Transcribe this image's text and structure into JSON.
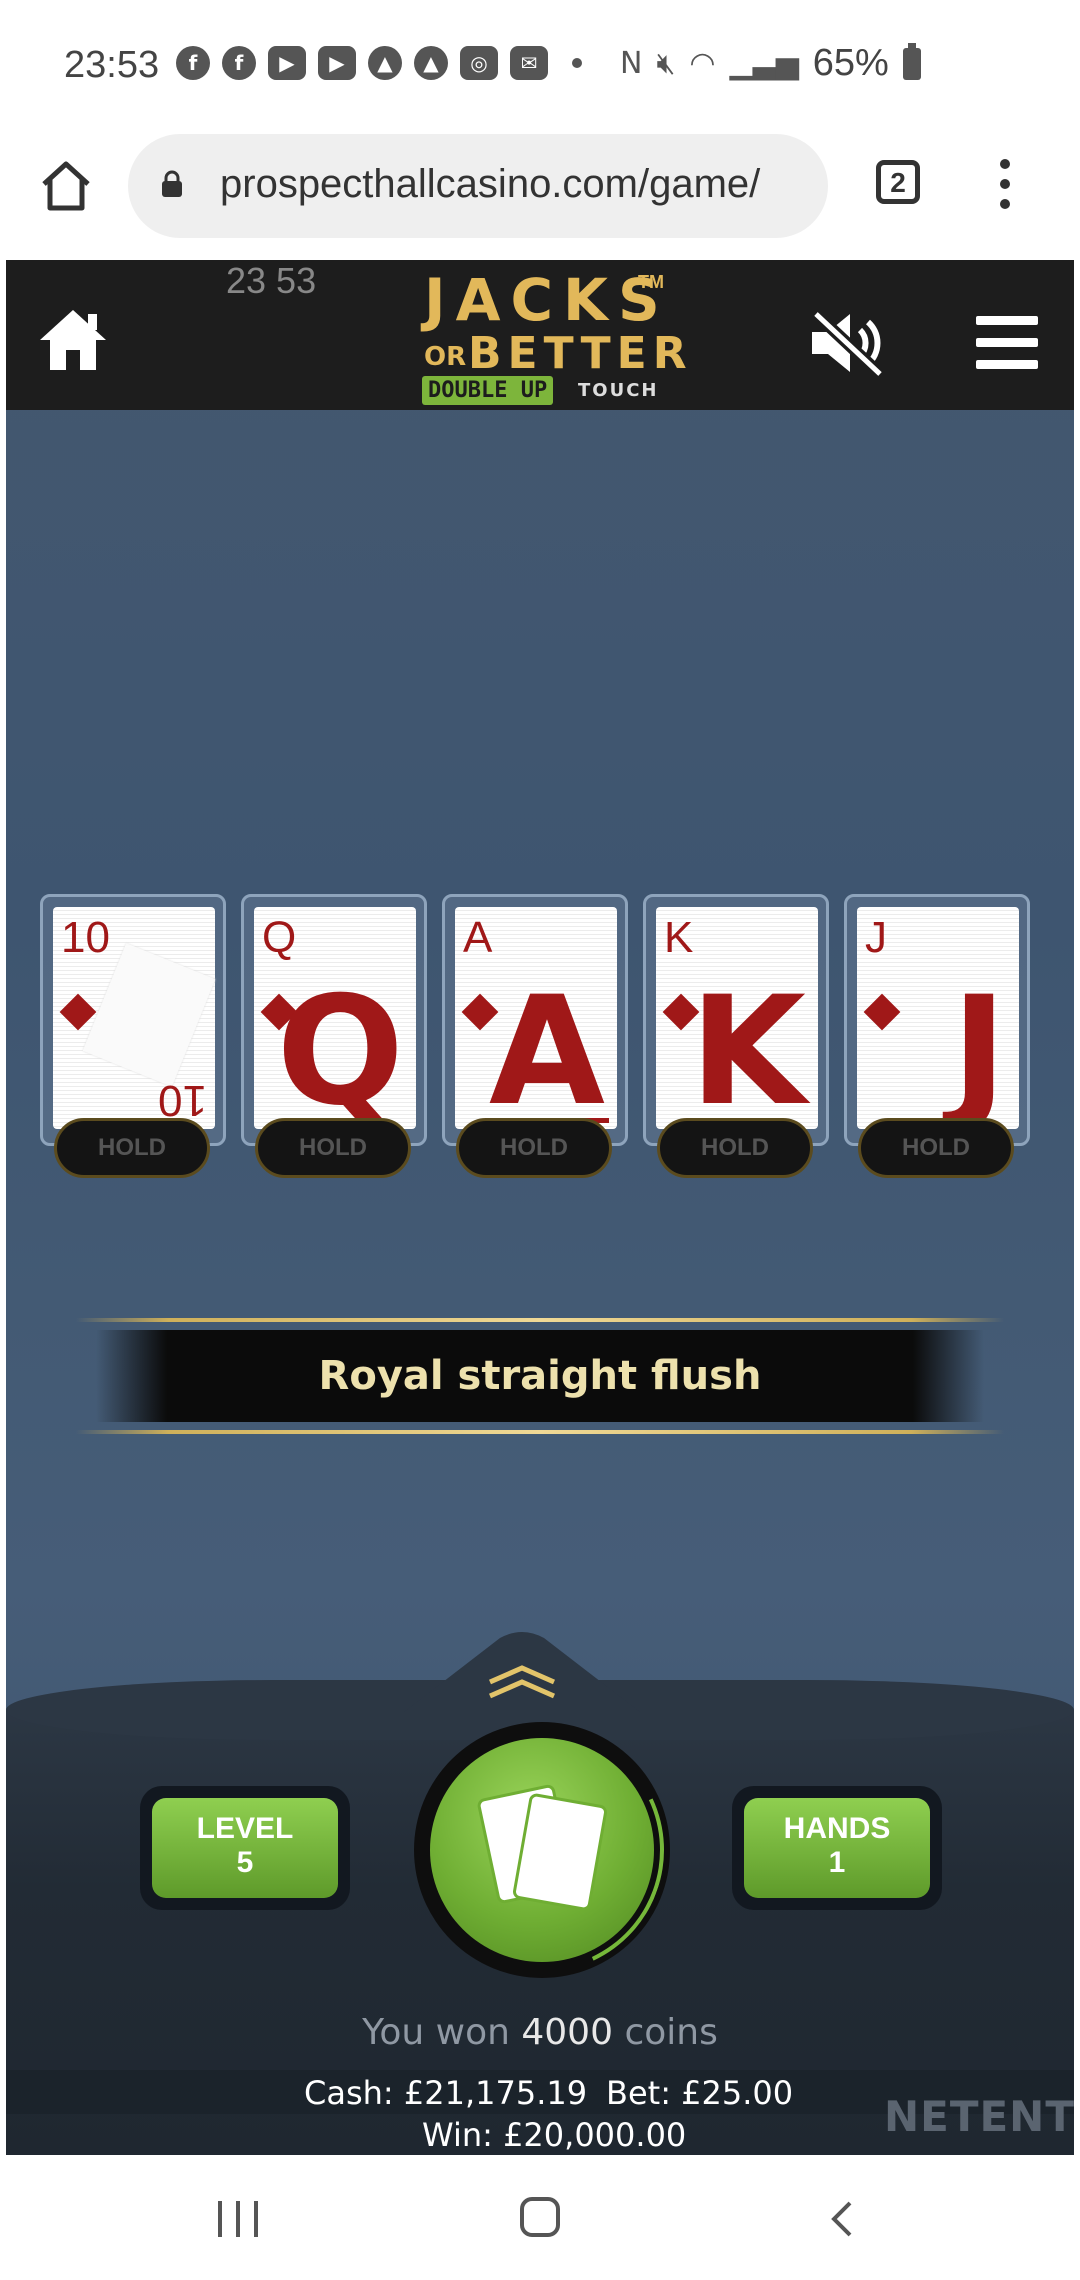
{
  "status_bar": {
    "time": "23:53",
    "battery": "65%"
  },
  "browser": {
    "url": "prospecthallcasino.com/game/",
    "tab_count": "2"
  },
  "game": {
    "clock": "23 53",
    "logo": {
      "jacks": "JACKS",
      "tm": "TM",
      "or": "OR",
      "better": "BETTER",
      "double_up": "DOUBLE UP",
      "touch": "TOUCH"
    },
    "cards": [
      {
        "rank": "10",
        "suit": "diamonds",
        "face": "",
        "hold_label": "HOLD"
      },
      {
        "rank": "Q",
        "suit": "diamonds",
        "face": "Q",
        "hold_label": "HOLD"
      },
      {
        "rank": "A",
        "suit": "diamonds",
        "face": "A",
        "hold_label": "HOLD"
      },
      {
        "rank": "K",
        "suit": "diamonds",
        "face": "K",
        "hold_label": "HOLD"
      },
      {
        "rank": "J",
        "suit": "diamonds",
        "face": "J",
        "hold_label": "HOLD"
      }
    ],
    "result_text": "Royal straight flush",
    "level": {
      "label": "LEVEL",
      "value": "5"
    },
    "hands": {
      "label": "HANDS",
      "value": "1"
    },
    "win_message": {
      "prefix": "You won",
      "amount": "4000",
      "suffix": "coins"
    },
    "cash": "Cash: £21,175.19",
    "bet": "Bet: £25.00",
    "win": "Win: £20,000.00",
    "provider": "NETENT",
    "colors": {
      "felt": "#3f5670",
      "accent_green": "#7db53b",
      "logo_gold": "#e2b85a",
      "card_red": "#a01818"
    }
  }
}
